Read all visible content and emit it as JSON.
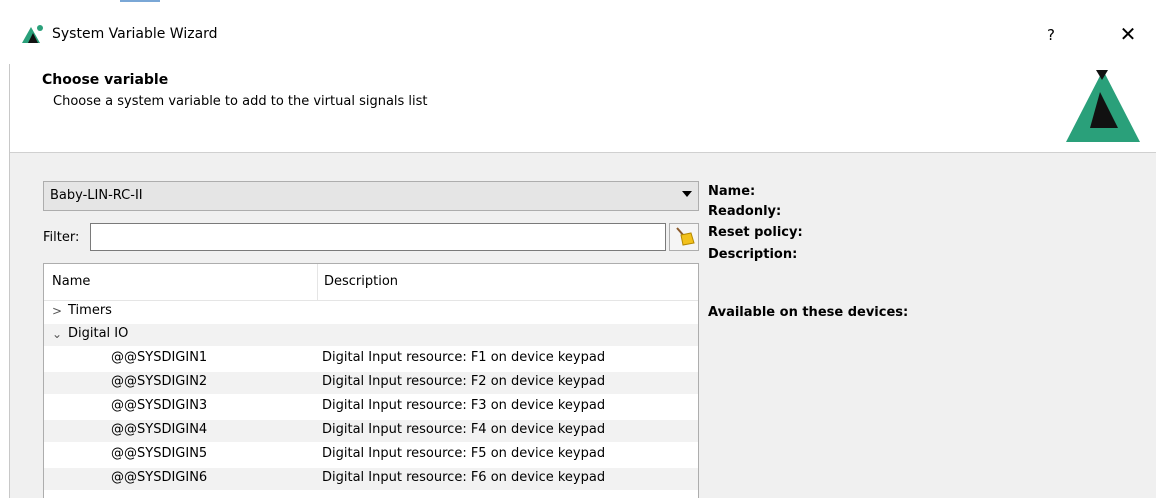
{
  "window": {
    "title": "System Variable Wizard",
    "help_label": "?",
    "close_label": "✕"
  },
  "header": {
    "title": "Choose variable",
    "subtitle": "Choose a system variable to add to the virtual signals list"
  },
  "device_select": {
    "value": "Baby-LIN-RC-II"
  },
  "filter": {
    "label": "Filter:",
    "value": "",
    "placeholder": ""
  },
  "tree": {
    "columns": [
      "Name",
      "Description"
    ],
    "groups": [
      {
        "label": "Timers",
        "expanded": false
      },
      {
        "label": "Digital IO",
        "expanded": true
      }
    ],
    "rows": [
      {
        "name": "@@SYSDIGIN1",
        "description": "Digital Input resource: F1 on device keypad"
      },
      {
        "name": "@@SYSDIGIN2",
        "description": "Digital Input resource: F2 on device keypad"
      },
      {
        "name": "@@SYSDIGIN3",
        "description": "Digital Input resource: F3 on device keypad"
      },
      {
        "name": "@@SYSDIGIN4",
        "description": "Digital Input resource: F4 on device keypad"
      },
      {
        "name": "@@SYSDIGIN5",
        "description": "Digital Input resource: F5 on device keypad"
      },
      {
        "name": "@@SYSDIGIN6",
        "description": "Digital Input resource: F6 on device keypad"
      }
    ]
  },
  "properties": {
    "name_label": "Name:",
    "readonly_label": "Readonly:",
    "reset_policy_label": "Reset policy:",
    "description_label": "Description:",
    "available_label": "Available on these devices:"
  },
  "colors": {
    "brand_green": "#2aa07a",
    "brand_black": "#111111"
  }
}
